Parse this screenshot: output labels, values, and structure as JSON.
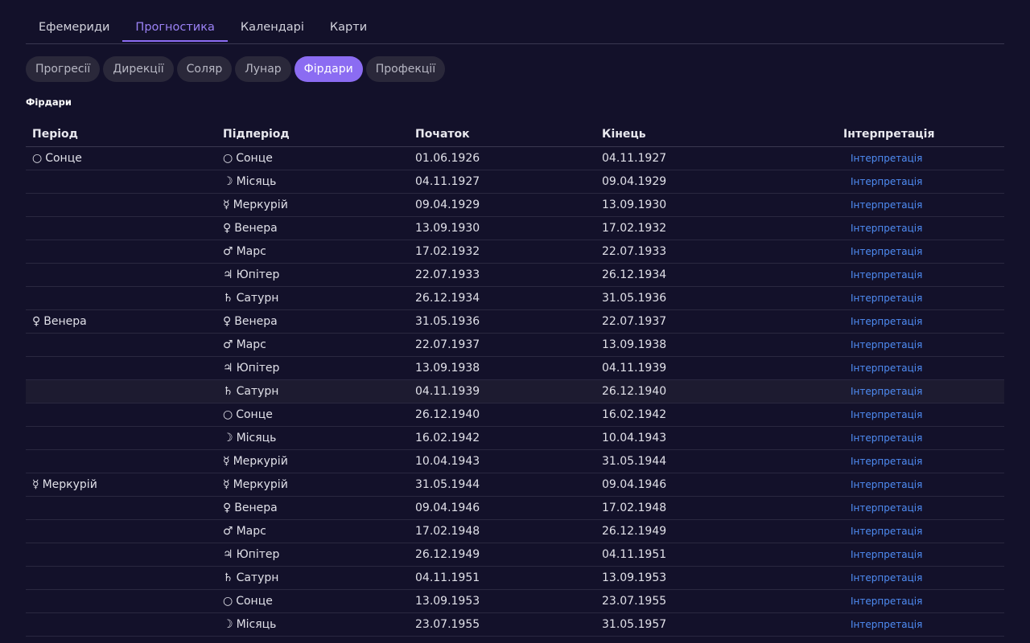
{
  "tabs": {
    "main": [
      "Ефемериди",
      "Прогностика",
      "Календарі",
      "Карти"
    ],
    "main_active_index": 1,
    "sub": [
      "Прогресії",
      "Дирекції",
      "Соляр",
      "Лунар",
      "Фірдари",
      "Профекції"
    ],
    "sub_active_index": 4
  },
  "section": {
    "title": "Фірдари"
  },
  "table": {
    "headers": [
      "Період",
      "Підперіод",
      "Початок",
      "Кінець",
      "Інтерпретація"
    ],
    "link_label": "Інтерпретація",
    "hover_row_index": 10,
    "rows": [
      {
        "period_glyph": "○",
        "period": "Сонце",
        "sub_glyph": "○",
        "sub": "Сонце",
        "start": "01.06.1926",
        "end": "04.11.1927"
      },
      {
        "period_glyph": "",
        "period": "",
        "sub_glyph": "☽",
        "sub": "Місяць",
        "start": "04.11.1927",
        "end": "09.04.1929"
      },
      {
        "period_glyph": "",
        "period": "",
        "sub_glyph": "☿",
        "sub": "Меркурій",
        "start": "09.04.1929",
        "end": "13.09.1930"
      },
      {
        "period_glyph": "",
        "period": "",
        "sub_glyph": "♀",
        "sub": "Венера",
        "start": "13.09.1930",
        "end": "17.02.1932"
      },
      {
        "period_glyph": "",
        "period": "",
        "sub_glyph": "♂",
        "sub": "Марс",
        "start": "17.02.1932",
        "end": "22.07.1933"
      },
      {
        "period_glyph": "",
        "period": "",
        "sub_glyph": "♃",
        "sub": "Юпітер",
        "start": "22.07.1933",
        "end": "26.12.1934"
      },
      {
        "period_glyph": "",
        "period": "",
        "sub_glyph": "♄",
        "sub": "Сатурн",
        "start": "26.12.1934",
        "end": "31.05.1936"
      },
      {
        "period_glyph": "♀",
        "period": "Венера",
        "sub_glyph": "♀",
        "sub": "Венера",
        "start": "31.05.1936",
        "end": "22.07.1937"
      },
      {
        "period_glyph": "",
        "period": "",
        "sub_glyph": "♂",
        "sub": "Марс",
        "start": "22.07.1937",
        "end": "13.09.1938"
      },
      {
        "period_glyph": "",
        "period": "",
        "sub_glyph": "♃",
        "sub": "Юпітер",
        "start": "13.09.1938",
        "end": "04.11.1939"
      },
      {
        "period_glyph": "",
        "period": "",
        "sub_glyph": "♄",
        "sub": "Сатурн",
        "start": "04.11.1939",
        "end": "26.12.1940"
      },
      {
        "period_glyph": "",
        "period": "",
        "sub_glyph": "○",
        "sub": "Сонце",
        "start": "26.12.1940",
        "end": "16.02.1942"
      },
      {
        "period_glyph": "",
        "period": "",
        "sub_glyph": "☽",
        "sub": "Місяць",
        "start": "16.02.1942",
        "end": "10.04.1943"
      },
      {
        "period_glyph": "",
        "period": "",
        "sub_glyph": "☿",
        "sub": "Меркурій",
        "start": "10.04.1943",
        "end": "31.05.1944"
      },
      {
        "period_glyph": "☿",
        "period": "Меркурій",
        "sub_glyph": "☿",
        "sub": "Меркурій",
        "start": "31.05.1944",
        "end": "09.04.1946"
      },
      {
        "period_glyph": "",
        "period": "",
        "sub_glyph": "♀",
        "sub": "Венера",
        "start": "09.04.1946",
        "end": "17.02.1948"
      },
      {
        "period_glyph": "",
        "period": "",
        "sub_glyph": "♂",
        "sub": "Марс",
        "start": "17.02.1948",
        "end": "26.12.1949"
      },
      {
        "period_glyph": "",
        "period": "",
        "sub_glyph": "♃",
        "sub": "Юпітер",
        "start": "26.12.1949",
        "end": "04.11.1951"
      },
      {
        "period_glyph": "",
        "period": "",
        "sub_glyph": "♄",
        "sub": "Сатурн",
        "start": "04.11.1951",
        "end": "13.09.1953"
      },
      {
        "period_glyph": "",
        "period": "",
        "sub_glyph": "○",
        "sub": "Сонце",
        "start": "13.09.1953",
        "end": "23.07.1955"
      },
      {
        "period_glyph": "",
        "period": "",
        "sub_glyph": "☽",
        "sub": "Місяць",
        "start": "23.07.1955",
        "end": "31.05.1957"
      }
    ]
  },
  "colors": {
    "background": "#13112a",
    "accent": "#8b6cf2",
    "link": "#4f8df5"
  }
}
